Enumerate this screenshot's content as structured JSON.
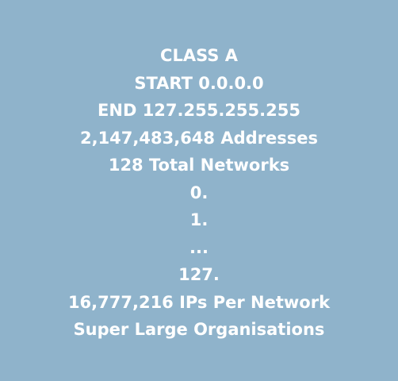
{
  "card": {
    "background": "#8fb3cb",
    "text_color": "#ffffff",
    "lines": [
      "CLASS A",
      "START 0.0.0.0",
      "END 127.255.255.255",
      "2,147,483,648 Addresses",
      "128 Total Networks",
      "0.",
      "1.",
      "...",
      "127.",
      "16,777,216 IPs Per Network",
      "Super Large Organisations"
    ]
  }
}
